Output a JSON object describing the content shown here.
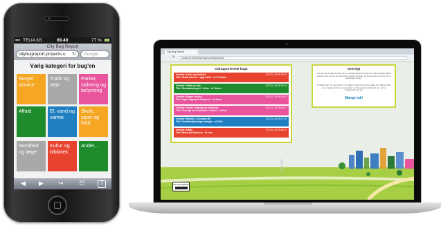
{
  "phone": {
    "status": {
      "carrier": "TELIA",
      "network": "3G",
      "time": "09.40",
      "battery": "77 %"
    },
    "browser": {
      "title": "City Bug Report",
      "url": "citybugreport.projects.u",
      "search_placeholder": "Google"
    },
    "heading": "Vælg kategori for bug'en",
    "categories": [
      {
        "label": "Borger service",
        "color": "#f5a623"
      },
      {
        "label": "Trafik og Veje",
        "color": "#a8a8a8"
      },
      {
        "label": "Parker, skiltning og belysning",
        "color": "#e8559c"
      },
      {
        "label": "Affald",
        "color": "#1e8c2c"
      },
      {
        "label": "El, vand og varme",
        "color": "#1f7fc0"
      },
      {
        "label": "Skole, sport og fritid",
        "color": "#f5a623"
      },
      {
        "label": "Sundhed og læge",
        "color": "#a8a8a8"
      },
      {
        "label": "Kultur og bibliotek",
        "color": "#e8432f"
      },
      {
        "label": "Andet...",
        "color": "#1e8c2c"
      }
    ],
    "toolbar_icons": [
      "back-icon",
      "forward-icon",
      "share-icon",
      "bookmarks-icon",
      "tabs-icon"
    ],
    "tabs_count": "2"
  },
  "laptop": {
    "tab_title": "City Bug Report",
    "address": "localhost:3000/citybugreport/display.php",
    "bugs_panel": {
      "title": "Indrapporterede bugs",
      "items": [
        {
          "line1": "Område: Kultur og bibliotek",
          "line2": "Titel: Gratis Internet - sygt meld? - af Christian",
          "date": "2013-11-18 08:25:00",
          "color": "#e8432f"
        },
        {
          "line1": "Område: Trafik og Veje",
          "line2": "Titel: Skandalelængsel - Huller - af Torben",
          "date": "2013-11-18 08:22:10",
          "color": "#1e8c2c"
        },
        {
          "line1": "Område: Borger service",
          "line2": "Titel: Ingen adgang til telepenne - af Janne",
          "date": "2013-11-18 08:20:02",
          "color": "#e8559c"
        },
        {
          "line1": "Område: Parker, skiltning og belysning",
          "line2": "Titel: Oversigt over P-pladser i Aarhus - af Poul",
          "date": "2013-11-18 08:18:07",
          "color": "#e8559c"
        },
        {
          "line1": "Område: Website - Is Aarhus.dk",
          "line2": "Titel: Kontaktoplysninger mangler - af Ditte",
          "date": "2013-11-18 08:17:40",
          "color": "#1f7fc0"
        },
        {
          "line1": "Område: Affald",
          "line2": "Titel: Brand på Skadeorn - af Lars",
          "date": "2013-11-18 08:15:01",
          "color": "#e8432f"
        }
      ]
    },
    "info_panel": {
      "title": "Oversigt",
      "text1": "Her kan du se alle de bugs der er indrapporteret til systemet. Vær at klikke på de enkelte, kan man få en helt bestemmelse af bugen og besvare den hvis den hos ansvarlige findes.",
      "text2": "Området den 31. december er områdes bugs blive gennemgået for at få overblik over engagementet og potentialet i en bug-bug begivenhed og - deres indrapporter her på.",
      "thanks": "Mange tak!"
    },
    "badge": "CITY BUG REPORT"
  }
}
